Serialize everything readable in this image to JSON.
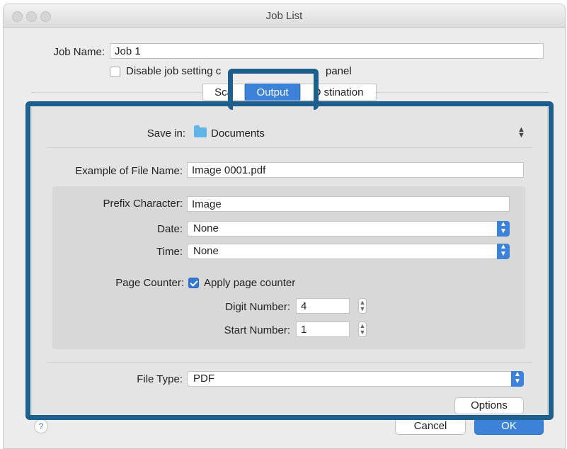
{
  "window": {
    "title": "Job List"
  },
  "job": {
    "name_label": "Job Name:",
    "name_value": "Job 1",
    "disable_label": "Disable job setting c",
    "disable_label_tail": "panel"
  },
  "tabs": [
    {
      "label": "Sca",
      "selected": false
    },
    {
      "label": "Output",
      "selected": true
    },
    {
      "label": "D  stination",
      "selected": false
    }
  ],
  "output": {
    "save_in_label": "Save in:",
    "save_in_value": "Documents",
    "example_label": "Example of File Name:",
    "example_value": "Image 0001.pdf",
    "prefix_label": "Prefix Character:",
    "prefix_value": "Image",
    "date_label": "Date:",
    "date_value": "None",
    "time_label": "Time:",
    "time_value": "None",
    "page_counter_label": "Page Counter:",
    "apply_counter_label": "Apply page counter",
    "apply_counter_checked": true,
    "digit_label": "Digit Number:",
    "digit_value": "4",
    "start_label": "Start Number:",
    "start_value": "1",
    "file_type_label": "File Type:",
    "file_type_value": "PDF",
    "options_label": "Options"
  },
  "footer": {
    "help_symbol": "?",
    "cancel_label": "Cancel",
    "ok_label": "OK"
  },
  "colors": {
    "accent": "#3d82d9",
    "highlight": "#1f5f8e"
  }
}
